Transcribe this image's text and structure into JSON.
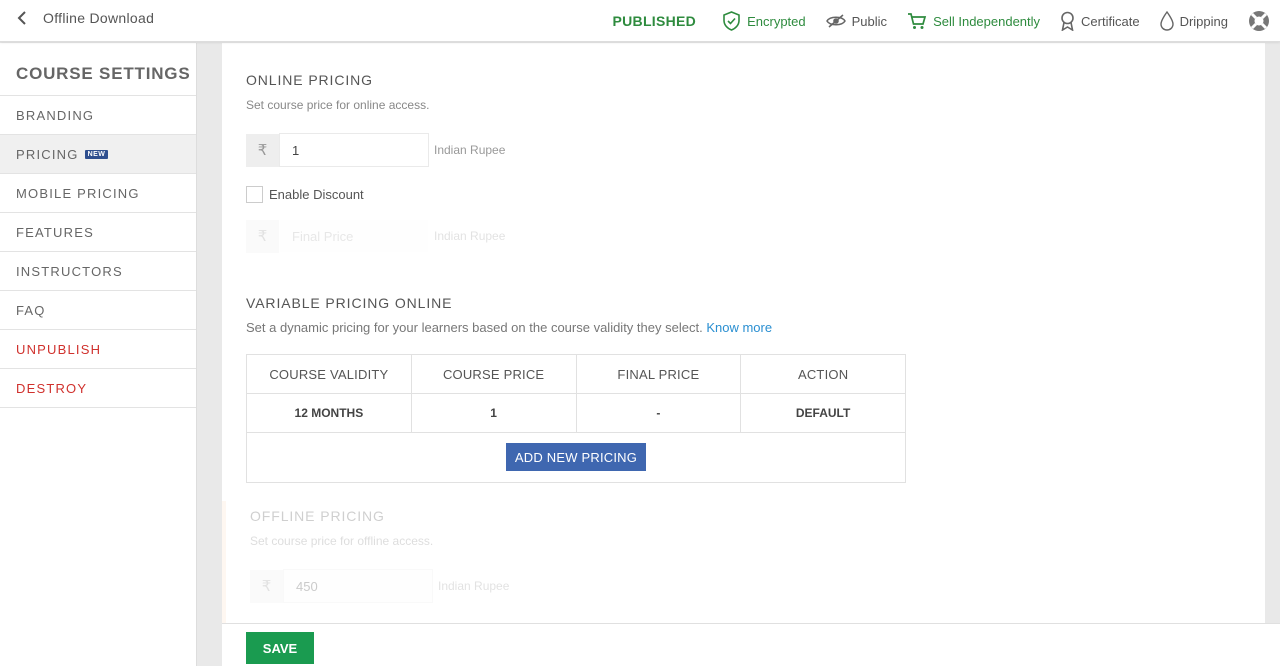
{
  "header": {
    "back_label": "Offline Download",
    "status": "PUBLISHED",
    "items": [
      {
        "label": "Encrypted",
        "icon": "shield-check-icon"
      },
      {
        "label": "Public",
        "icon": "eye-slash-icon"
      },
      {
        "label": "Sell Independently",
        "icon": "cart-icon"
      },
      {
        "label": "Certificate",
        "icon": "ribbon-icon"
      },
      {
        "label": "Dripping",
        "icon": "drop-icon"
      }
    ],
    "help_icon": "lifebuoy-icon"
  },
  "colors": {
    "published": "#2e8b3e",
    "danger": "#d0312d",
    "primary_button": "#3f67b0",
    "save_button": "#1a9b50",
    "link": "#2a8fd1"
  },
  "sidebar": {
    "title": "COURSE SETTINGS",
    "items": [
      {
        "label": "BRANDING"
      },
      {
        "label": "PRICING",
        "badge": "NEW",
        "active": true
      },
      {
        "label": "MOBILE PRICING"
      },
      {
        "label": "FEATURES"
      },
      {
        "label": "INSTRUCTORS"
      },
      {
        "label": "FAQ"
      },
      {
        "label": "UNPUBLISH",
        "danger": true
      },
      {
        "label": "DESTROY",
        "danger": true
      }
    ]
  },
  "online_pricing": {
    "title": "ONLINE PRICING",
    "description": "Set course price for online access.",
    "currency_symbol": "₹",
    "price_value": "1",
    "currency_label": "Indian Rupee",
    "enable_discount_label": "Enable Discount",
    "final_price_placeholder": "Final Price",
    "final_currency_label": "Indian Rupee"
  },
  "variable_pricing": {
    "title": "VARIABLE PRICING ONLINE",
    "description": "Set a dynamic pricing for your learners based on the course validity they select.",
    "know_more": "Know more",
    "columns": [
      "COURSE VALIDITY",
      "COURSE PRICE",
      "FINAL PRICE",
      "ACTION"
    ],
    "rows": [
      [
        "12 MONTHS",
        "1",
        "-",
        "DEFAULT"
      ]
    ],
    "add_button": "ADD NEW PRICING"
  },
  "offline_pricing": {
    "title": "OFFLINE PRICING",
    "description": "Set course price for offline access.",
    "currency_symbol": "₹",
    "price_value": "450",
    "currency_label": "Indian Rupee"
  },
  "footer": {
    "save_label": "SAVE"
  }
}
